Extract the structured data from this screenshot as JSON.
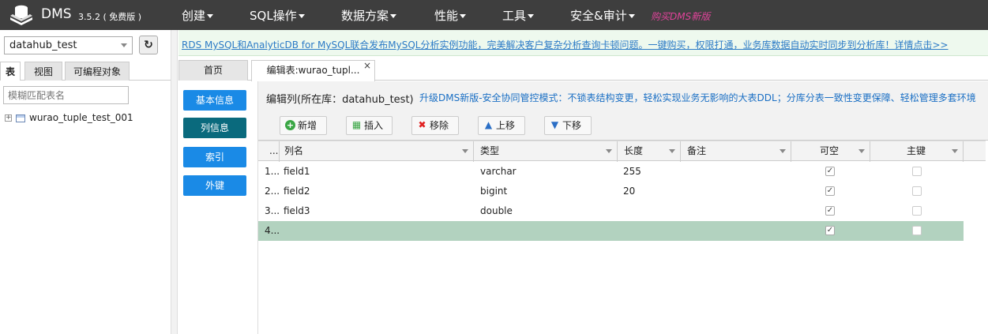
{
  "app": {
    "name": "DMS",
    "version": "3.5.2 ( 免费版 )"
  },
  "topnav": [
    {
      "label": "创建"
    },
    {
      "label": "SQL操作"
    },
    {
      "label": "数据方案"
    },
    {
      "label": "性能"
    },
    {
      "label": "工具"
    },
    {
      "label": "安全&审计"
    }
  ],
  "promo": "购买DMS新版",
  "left": {
    "db_selected": "datahub_test",
    "tabs": [
      "表",
      "视图",
      "可编程对象"
    ],
    "filter_placeholder": "模糊匹配表名",
    "tree": [
      {
        "label": "wurao_tuple_test_001"
      }
    ]
  },
  "infobar": "RDS MySQL和AnalyticDB for MySQL联合发布MySQL分析实例功能，完美解决客户复杂分析查询卡顿问题。一键购买，权限打通，业务库数据自动实时同步到分析库！详情点击>>",
  "tabs": [
    {
      "label": "首页"
    },
    {
      "label": "编辑表:wurao_tupl..."
    }
  ],
  "side_buttons": [
    "基本信息",
    "列信息",
    "索引",
    "外键"
  ],
  "content": {
    "title": "编辑列(所在库：datahub_test)",
    "upgrade": "升级DMS新版-安全协同管控模式：不锁表结构变更，轻松实现业务无影响的大表DDL；分库分表一致性变更保障、轻松管理多套环境"
  },
  "toolbar": {
    "add": "新增",
    "insert": "插入",
    "remove": "移除",
    "up": "上移",
    "down": "下移"
  },
  "grid": {
    "columns": [
      "...",
      "列名",
      "类型",
      "长度",
      "备注",
      "可空",
      "主键"
    ],
    "rows": [
      {
        "idx": "1...",
        "name": "field1",
        "type": "varchar",
        "length": "255",
        "comment": "",
        "nullable": true,
        "pk": false
      },
      {
        "idx": "2...",
        "name": "field2",
        "type": "bigint",
        "length": "20",
        "comment": "",
        "nullable": true,
        "pk": false
      },
      {
        "idx": "3...",
        "name": "field3",
        "type": "double",
        "length": "",
        "comment": "",
        "nullable": true,
        "pk": false
      },
      {
        "idx": "4...",
        "name": "",
        "type": "",
        "length": "",
        "comment": "",
        "nullable": true,
        "pk": false
      }
    ]
  },
  "colors": {
    "topbar": "#3e3e3e",
    "accent": "#1a8ae6",
    "selected_row": "#b2d2bf",
    "promo": "#e0439a"
  }
}
